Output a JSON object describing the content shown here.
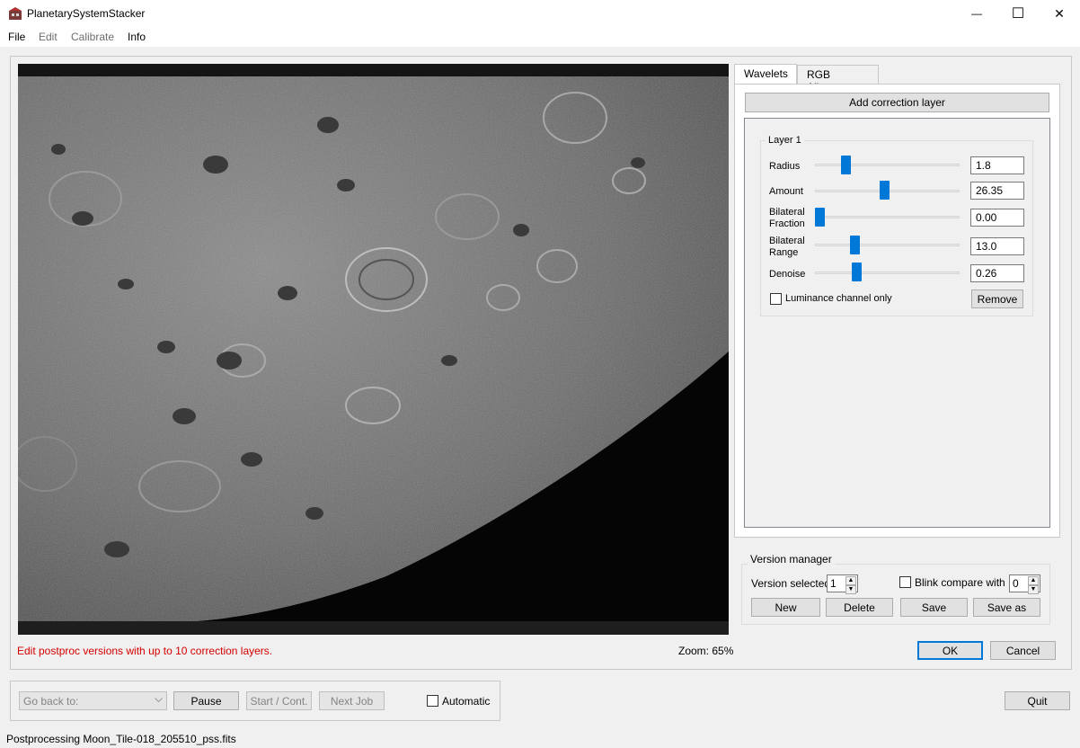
{
  "window": {
    "title": "PlanetarySystemStacker",
    "minimize_glyph": "—",
    "maximize_glyph": "☐",
    "close_glyph": "✕"
  },
  "menu": {
    "items": [
      {
        "label": "File",
        "enabled": true
      },
      {
        "label": "Edit",
        "enabled": false
      },
      {
        "label": "Calibrate",
        "enabled": false
      },
      {
        "label": "Info",
        "enabled": true
      }
    ]
  },
  "tabs": [
    {
      "label": "Wavelets",
      "active": true
    },
    {
      "label": "RGB Alignment",
      "active": false
    }
  ],
  "wavelets": {
    "add_layer_label": "Add correction layer",
    "layer_title": "Layer 1",
    "params": [
      {
        "label": "Radius",
        "value": "1.8",
        "slider_fraction": 0.19
      },
      {
        "label": "Amount",
        "value": "26.35",
        "slider_fraction": 0.48
      },
      {
        "label": "Bilateral\nFraction",
        "value": "0.00",
        "slider_fraction": 0.0
      },
      {
        "label": "Bilateral\nRange",
        "value": "13.0",
        "slider_fraction": 0.26
      },
      {
        "label": "Denoise",
        "value": "0.26",
        "slider_fraction": 0.27
      }
    ],
    "luminance_label": "Luminance channel only",
    "luminance_checked": false,
    "remove_label": "Remove"
  },
  "version_manager": {
    "title": "Version manager",
    "selected_label": "Version selected",
    "selected_value": "1",
    "blink_label": "Blink compare with",
    "blink_checked": false,
    "blink_value": "0",
    "new_label": "New",
    "delete_label": "Delete",
    "save_label": "Save",
    "save_as_label": "Save as"
  },
  "info_text": "Edit postproc versions with up to 10 correction layers.",
  "info_color": "#d40000",
  "zoom_text": "Zoom: 65%",
  "ok_label": "OK",
  "cancel_label": "Cancel",
  "bottom": {
    "go_back_placeholder": "Go back to:",
    "pause_label": "Pause",
    "start_label": "Start / Cont.",
    "next_job_label": "Next Job",
    "automatic_label": "Automatic",
    "automatic_checked": false,
    "quit_label": "Quit"
  },
  "status": "Postprocessing Moon_Tile-018_205510_pss.fits",
  "accent_color": "#0078d7"
}
